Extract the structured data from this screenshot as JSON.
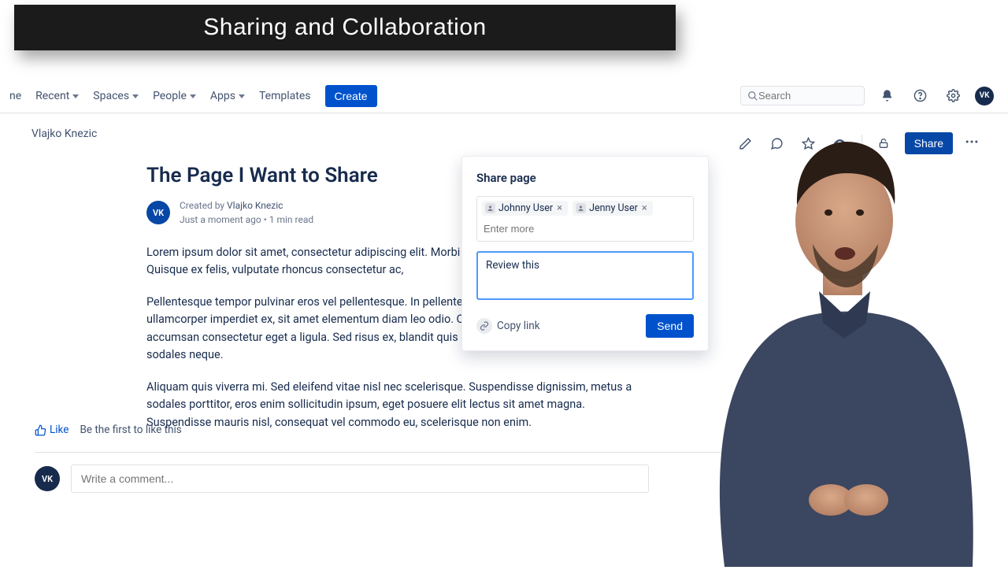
{
  "banner": {
    "title": "Sharing and Collaboration"
  },
  "nav": {
    "items": [
      {
        "label": "ne",
        "dropdown": false
      },
      {
        "label": "Recent",
        "dropdown": true
      },
      {
        "label": "Spaces",
        "dropdown": true
      },
      {
        "label": "People",
        "dropdown": true
      },
      {
        "label": "Apps",
        "dropdown": true
      },
      {
        "label": "Templates",
        "dropdown": false
      }
    ],
    "create": "Create",
    "search_placeholder": "Search",
    "avatar_initials": "VK"
  },
  "breadcrumb": {
    "space": "Vlajko Knezic"
  },
  "toolbar": {
    "share": "Share"
  },
  "article": {
    "title": "The Page I Want to Share",
    "avatar_initials": "VK",
    "created_by_label": "Created by",
    "author": "Vlajko Knezic",
    "meta_time": "Just a moment ago",
    "meta_read": "1 min read",
    "p1": "Lorem ipsum dolor sit amet, consectetur adipiscing elit. Morbi sit amet scelerisque dolor. Quisque ex felis, vulputate rhoncus consectetur ac,",
    "p2": "Pellentesque tempor pulvinar eros vel pellentesque. In pellentesque nisl eget nulla diam. Duis ullamcorper imperdiet ex, sit amet elementum diam leo odio. Quisque a dolor non tellus accumsan consectetur eget a ligula. Sed risus ex, blandit quis dui at, tincidunt porta odio. In quis sodales neque.",
    "p3": "Aliquam quis viverra mi. Sed eleifend vitae nisl nec scelerisque. Suspendisse dignissim, metus a sodales porttitor, eros enim sollicitudin ipsum, eget posuere elit lectus sit amet magna. Suspendisse mauris nisl, consequat vel commodo eu, scelerisque non enim."
  },
  "reactions": {
    "like": "Like",
    "prompt": "Be the first to like this"
  },
  "comment": {
    "avatar_initials": "VK",
    "placeholder": "Write a comment..."
  },
  "share_dialog": {
    "title": "Share page",
    "recipients": [
      {
        "name": "Johnny User"
      },
      {
        "name": "Jenny User"
      }
    ],
    "recipient_placeholder": "Enter more",
    "message": "Review this ",
    "copy_link": "Copy link",
    "send": "Send"
  }
}
